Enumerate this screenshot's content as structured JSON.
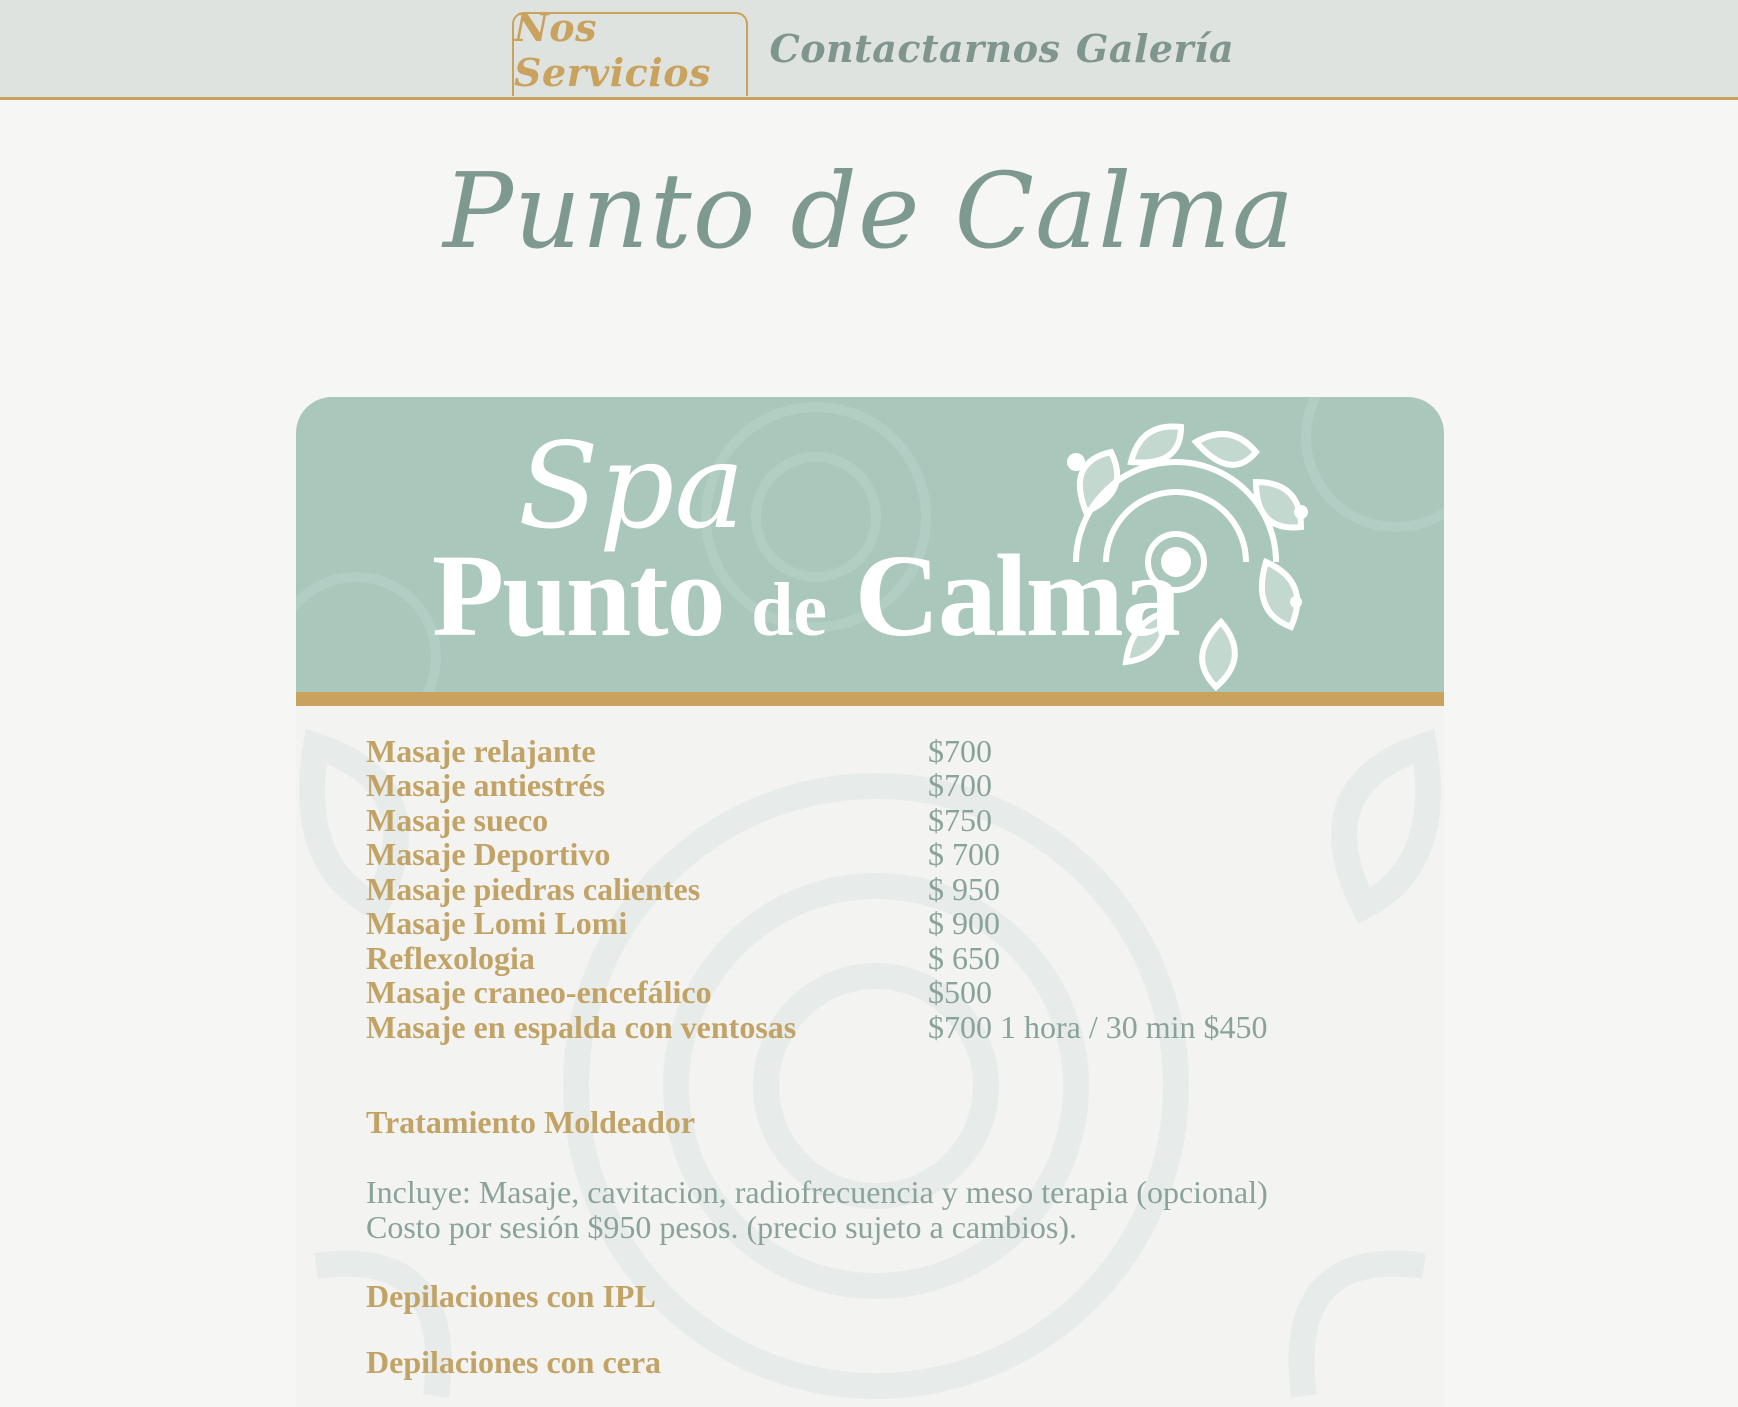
{
  "nav": {
    "tabs": [
      {
        "label": "Nos Servicios",
        "active": true
      },
      {
        "label": "Contactarnos",
        "active": false
      },
      {
        "label": "Galería",
        "active": false
      }
    ]
  },
  "site": {
    "title": "Punto de Calma"
  },
  "menu_card": {
    "header": {
      "spa": "Spa",
      "brand_part1": "Punto",
      "brand_part2": "de",
      "brand_part3": "Calma"
    },
    "services": [
      {
        "name": "Masaje relajante",
        "price": "$700"
      },
      {
        "name": "Masaje antiestrés",
        "price": "$700"
      },
      {
        "name": "Masaje sueco",
        "price": "$750"
      },
      {
        "name": "Masaje Deportivo",
        "price": "$ 700"
      },
      {
        "name": "Masaje piedras calientes",
        "price": "$ 950"
      },
      {
        "name": "Masaje Lomi Lomi",
        "price": "$ 900"
      },
      {
        "name": "Reflexologia",
        "price": "$ 650"
      },
      {
        "name": "Masaje craneo-encefálico",
        "price": "$500"
      },
      {
        "name": "Masaje en espalda con ventosas",
        "price": "$700 1 hora  / 30 min $450"
      }
    ],
    "treatment": {
      "heading": "Tratamiento Moldeador",
      "line1": "Incluye:  Masaje, cavitacion, radiofrecuencia y meso terapia (opcional)",
      "line2": "Costo por sesión $950 pesos. (precio sujeto a cambios)."
    },
    "ipl_heading": "Depilaciones con IPL",
    "wax_heading": "Depilaciones con cera"
  },
  "colors": {
    "gold": "#c9a25e",
    "sage": "#a9c7bb",
    "sage_text": "#7e9a90",
    "nav_bg": "#dfe3df"
  }
}
